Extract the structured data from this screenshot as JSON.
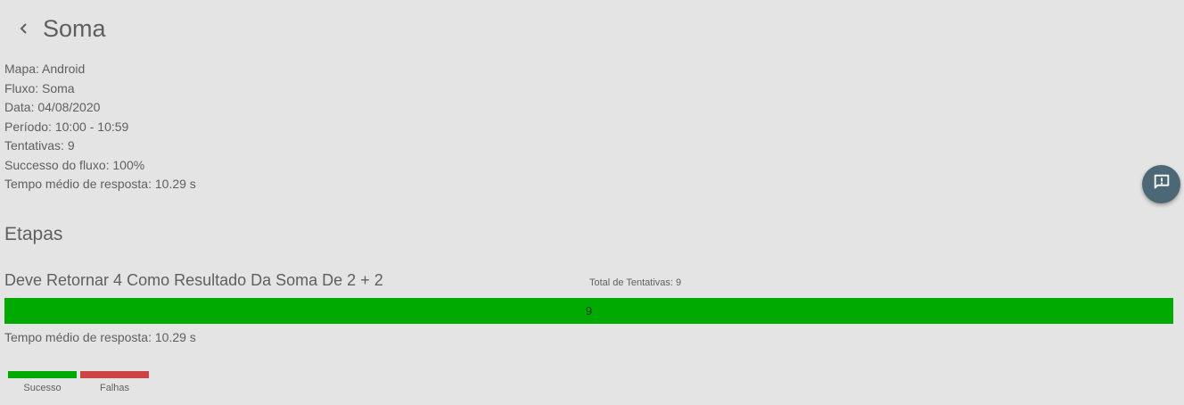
{
  "header": {
    "title": "Soma",
    "back_icon": "chevron-left-icon"
  },
  "info": {
    "rows": [
      "Mapa: Android",
      "Fluxo: Soma",
      "Data: 04/08/2020",
      "Período: 10:00 - 10:59",
      "Tentativas: 9",
      "Successo do fluxo: 100%",
      "Tempo médio de resposta: 10.29 s"
    ]
  },
  "feedback": {
    "icon": "feedback-icon",
    "color": "#4c6775"
  },
  "etapas": {
    "title": "Etapas",
    "steps": [
      {
        "title": "Deve Retornar 4 Como Resultado Da Soma De 2 + 2",
        "total_label": "Total de Tentativas: 9",
        "success_count": "9",
        "success_fraction": 1.0,
        "avg_response": "Tempo médio de resposta: 10.29 s"
      }
    ]
  },
  "legend": {
    "items": [
      {
        "label": "Sucesso",
        "color": "#00aa00"
      },
      {
        "label": "Falhas",
        "color": "#cc4444"
      }
    ]
  }
}
